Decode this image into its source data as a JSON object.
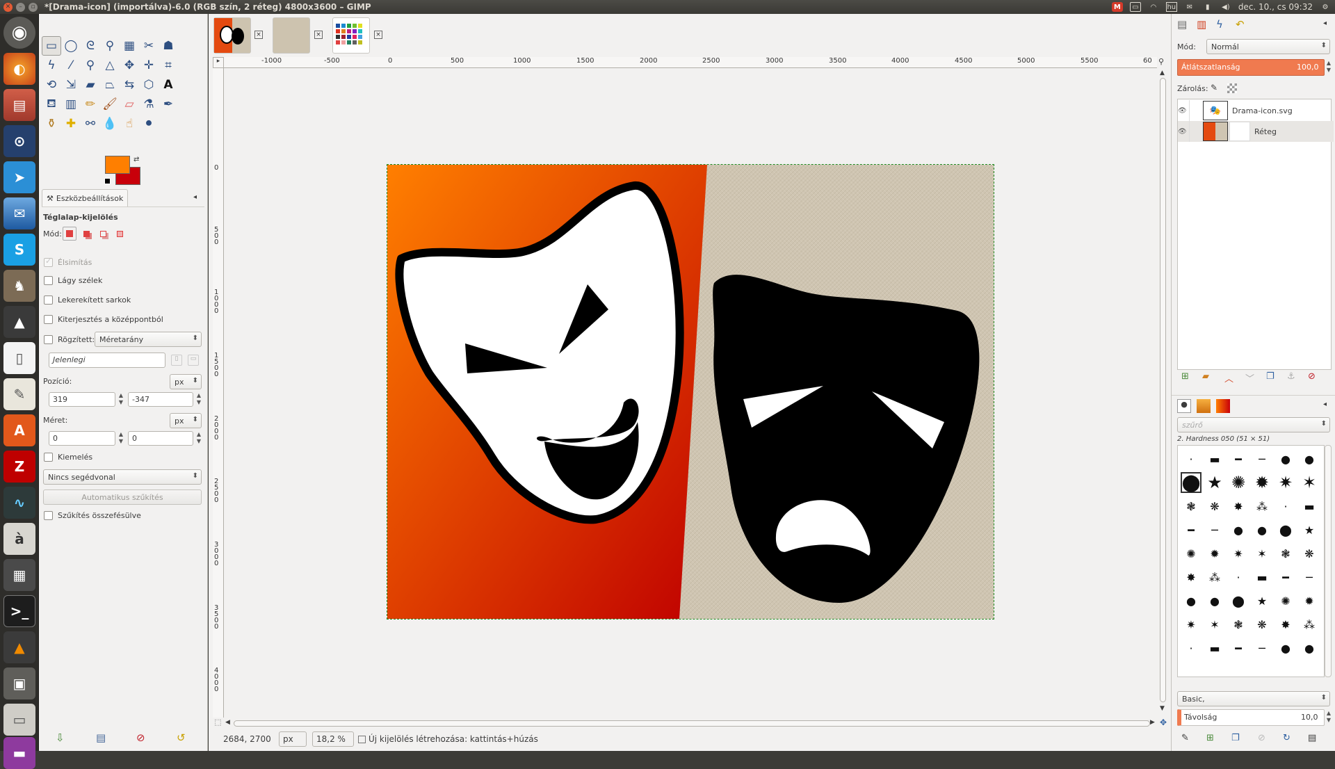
{
  "window": {
    "title": "*[Drama-icon] (importálva)-6.0 (RGB szín, 2 réteg) 4800x3600 – GIMP",
    "clock": "dec. 10., cs 09:32",
    "tray_icons": [
      "mail-m-icon",
      "keyboard-icon",
      "wifi-icon",
      "keyboard-layout-icon",
      "envelope-icon",
      "battery-icon",
      "volume-icon"
    ]
  },
  "toolbox": {
    "tool_options_tab": "Eszközbeállítások",
    "tool_name": "Téglalap-kijelölés",
    "mode_label": "Mód:",
    "antialias": "Élsimítás",
    "feather": "Lágy szélek",
    "rounded": "Lekerekített sarkok",
    "expand_center": "Kiterjesztés a középpontból",
    "fixed": "Rögzített:",
    "fixed_value": "Méretarány",
    "current": "Jelenlegi",
    "position_label": "Pozíció:",
    "position_unit": "px",
    "pos_x": "319",
    "pos_y": "-347",
    "size_label": "Méret:",
    "size_unit": "px",
    "size_w": "0",
    "size_h": "0",
    "highlight": "Kiemelés",
    "guides": "Nincs segédvonal",
    "auto_shrink": "Automatikus szűkítés",
    "shrink_merged": "Szűkítés összefésülve",
    "fg_color": "#ff7f00",
    "bg_color": "#c8000a"
  },
  "ruler": {
    "h_ticks": [
      "-1000",
      "-500",
      "0",
      "500",
      "1000",
      "1500",
      "2000",
      "2500",
      "3000",
      "3500",
      "4000",
      "4500",
      "5000",
      "5500",
      "60"
    ],
    "v_ticks": [
      "0",
      "500",
      "1000",
      "1500",
      "2000",
      "2500",
      "3000",
      "3500",
      "4000"
    ]
  },
  "status": {
    "coords": "2684, 2700",
    "unit": "px",
    "zoom": "18,2 %",
    "message": "Új kijelölés létrehozása: kattintás+húzás"
  },
  "layers": {
    "mode_label": "Mód:",
    "mode": "Normál",
    "opacity_label": "Átlátszatlanság",
    "opacity": "100,0",
    "lock_label": "Zárolás:",
    "items": [
      "Drama-icon.svg",
      "Réteg"
    ]
  },
  "brushes": {
    "filter_placeholder": "szűrő",
    "current": "2. Hardness 050 (51 × 51)",
    "preset": "Basic,",
    "spacing_label": "Távolság",
    "spacing": "10,0"
  }
}
